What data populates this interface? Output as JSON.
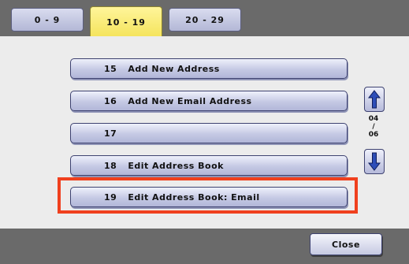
{
  "tabs": [
    {
      "label": "0 - 9"
    },
    {
      "label": "10 - 19"
    },
    {
      "label": "20 - 29"
    }
  ],
  "active_tab": "10 - 19",
  "items": [
    {
      "number": "15",
      "label": "Add New Address"
    },
    {
      "number": "16",
      "label": "Add New Email Address"
    },
    {
      "number": "17",
      "label": ""
    },
    {
      "number": "18",
      "label": "Edit Address Book"
    },
    {
      "number": "19",
      "label": "Edit Address Book: Email"
    }
  ],
  "highlighted_item": "19",
  "pager": {
    "current": "04",
    "separator": "/",
    "total": "06"
  },
  "buttons": {
    "close": "Close"
  },
  "colors": {
    "accent_highlight": "#f0401e",
    "active_tab": "#f4e35a",
    "button": "#c5c9e4",
    "chrome": "#6a6a6a"
  }
}
